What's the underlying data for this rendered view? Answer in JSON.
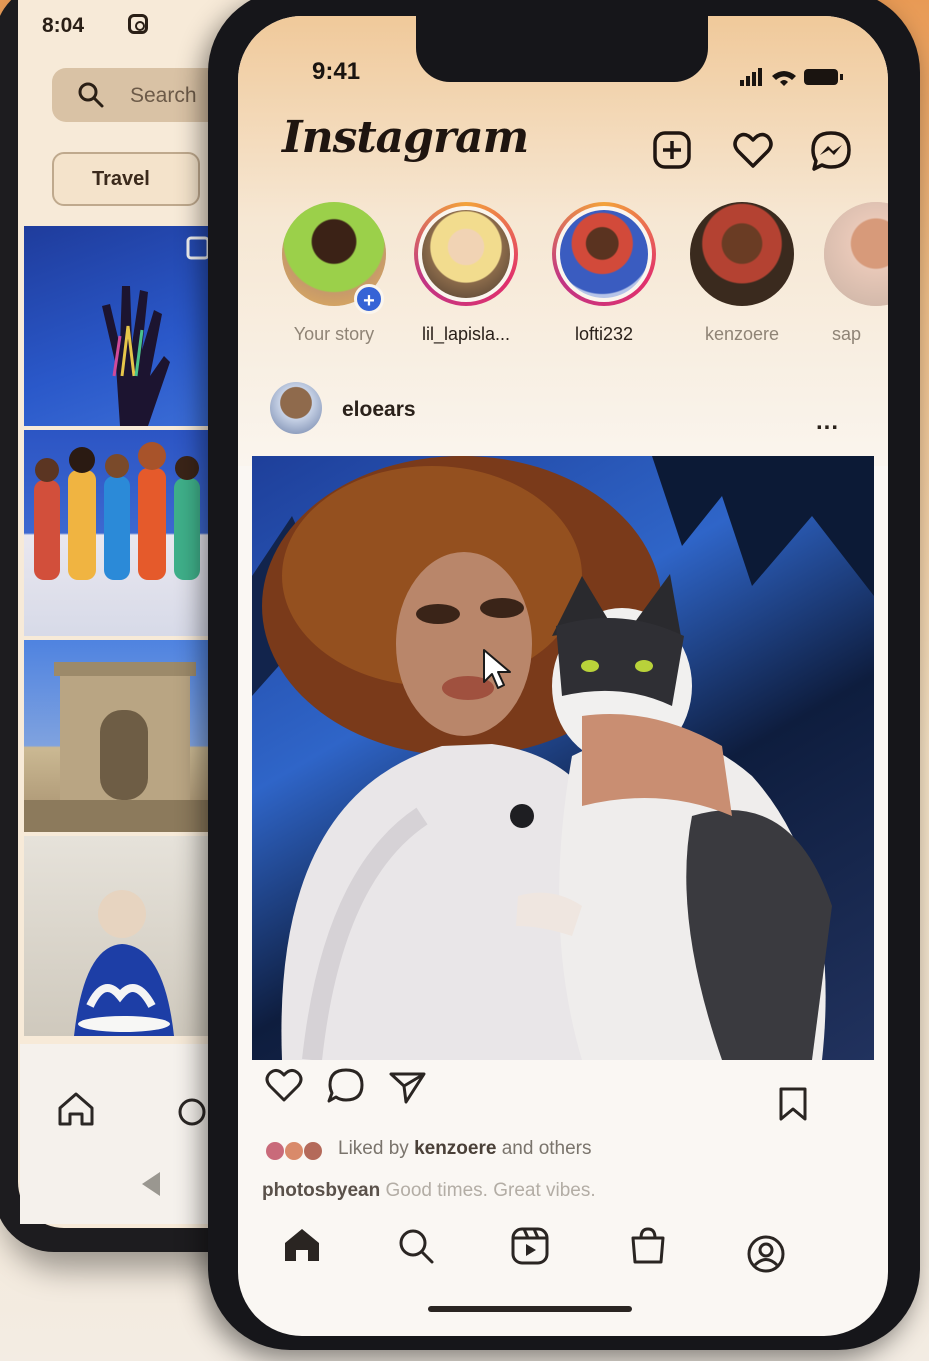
{
  "back_phone": {
    "time": "8:04",
    "search_placeholder": "Search",
    "chip_label": "Travel"
  },
  "front_phone": {
    "time": "9:41",
    "app_logo": "Instagram",
    "header_icons": [
      "new-post-icon",
      "heart-icon",
      "messenger-icon"
    ],
    "stories": [
      {
        "label": "Your story",
        "active": false,
        "is_own": true
      },
      {
        "label": "lil_lapisla...",
        "active": true
      },
      {
        "label": "lofti232",
        "active": true
      },
      {
        "label": "kenzoere",
        "active": false
      },
      {
        "label": "sap",
        "active": false
      }
    ],
    "post": {
      "username": "eloears",
      "more": "...",
      "liked_prefix": "Liked by",
      "liked_user": "kenzoere",
      "liked_suffix": "and others",
      "caption_user": "photosbyean",
      "caption_text": "Good times. Great vibes."
    },
    "action_icons": [
      "like-icon",
      "comment-icon",
      "share-icon",
      "save-icon"
    ],
    "tab_icons": [
      "home-icon",
      "search-icon",
      "reels-icon",
      "shop-icon",
      "profile-icon"
    ]
  },
  "colors": {
    "story_ring": "#e1306c",
    "badge": "#3563d6",
    "phone_frame": "#16161a"
  }
}
